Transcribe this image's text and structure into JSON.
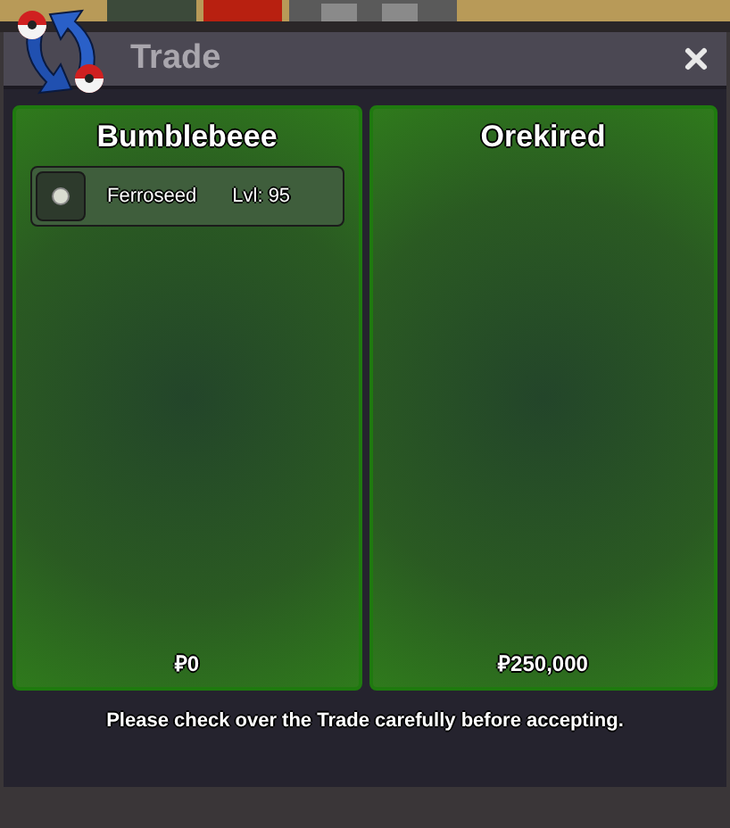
{
  "window": {
    "title": "Trade"
  },
  "panels": [
    {
      "name": "Bumblebeee",
      "items": [
        {
          "name": "Ferroseed",
          "level": "Lvl: 95"
        }
      ],
      "money": "₽0"
    },
    {
      "name": "Orekired",
      "money": "₽250,000"
    }
  ],
  "notice": "Please check over the Trade carefully before accepting."
}
